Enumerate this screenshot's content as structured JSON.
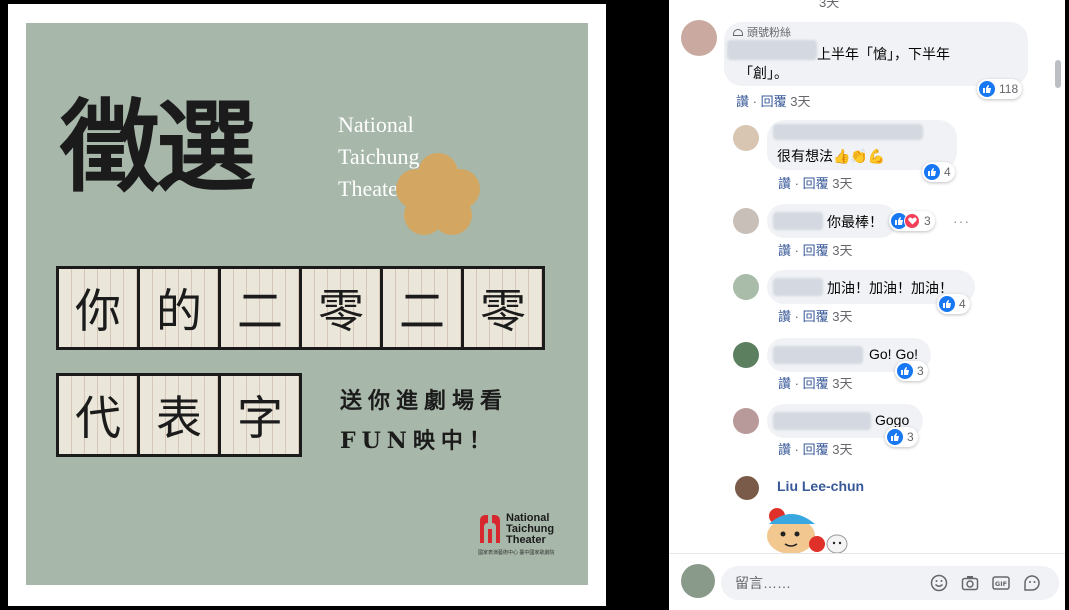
{
  "poster": {
    "headline": "徵選",
    "venue_lines": [
      "National",
      "Taichung",
      "Theater"
    ],
    "grid_row1": [
      "你",
      "的",
      "二",
      "零",
      "二",
      "零"
    ],
    "grid_row2": [
      "代",
      "表",
      "字"
    ],
    "tagline_line1": "送你進劇場看",
    "tagline_line2": "FUN映中！",
    "logo_lines": [
      "National",
      "Taichung",
      "Theater"
    ],
    "logo_subtitle": "國家表演藝術中心 臺中國家歌劇院",
    "colors": {
      "background": "#a7b7a9",
      "flower": "#d3a761",
      "text": "#1b1b1b"
    }
  },
  "comments": {
    "top_cut": "3天",
    "c1": {
      "badge": "頭號粉絲",
      "text_line1": "上半年「愴」，下半年",
      "text_line2": "「創」。",
      "reply_label": "讚",
      "sep": "·",
      "reply_action": "回覆",
      "time": "3天",
      "reactions": "118"
    },
    "c2": {
      "text": "很有想法👍👏💪",
      "like": "讚",
      "sep": "·",
      "reply": "回覆",
      "time": "3天",
      "reactions": "4"
    },
    "c3": {
      "text": "你最棒！",
      "like": "讚",
      "sep": "·",
      "reply": "回覆",
      "time": "3天",
      "reactions": "3"
    },
    "c4": {
      "text": "加油！加油！加油！",
      "like": "讚",
      "sep": "·",
      "reply": "回覆",
      "time": "3天",
      "reactions": "4"
    },
    "c5": {
      "text": "Go! Go!",
      "like": "讚",
      "sep": "·",
      "reply": "回覆",
      "time": "3天",
      "reactions": "3"
    },
    "c6": {
      "text": "Gogo",
      "like": "讚",
      "sep": "·",
      "reply": "回覆",
      "time": "3天",
      "reactions": "3"
    },
    "c7": {
      "author": "Liu Lee-chun"
    },
    "more": "···"
  },
  "composer": {
    "placeholder": "留言……",
    "icons": [
      "emoji-icon",
      "camera-icon",
      "gif-icon",
      "sticker-icon"
    ]
  },
  "colors": {
    "link": "#385898",
    "like_blue": "#1877f2",
    "love_red": "#f33e58"
  }
}
